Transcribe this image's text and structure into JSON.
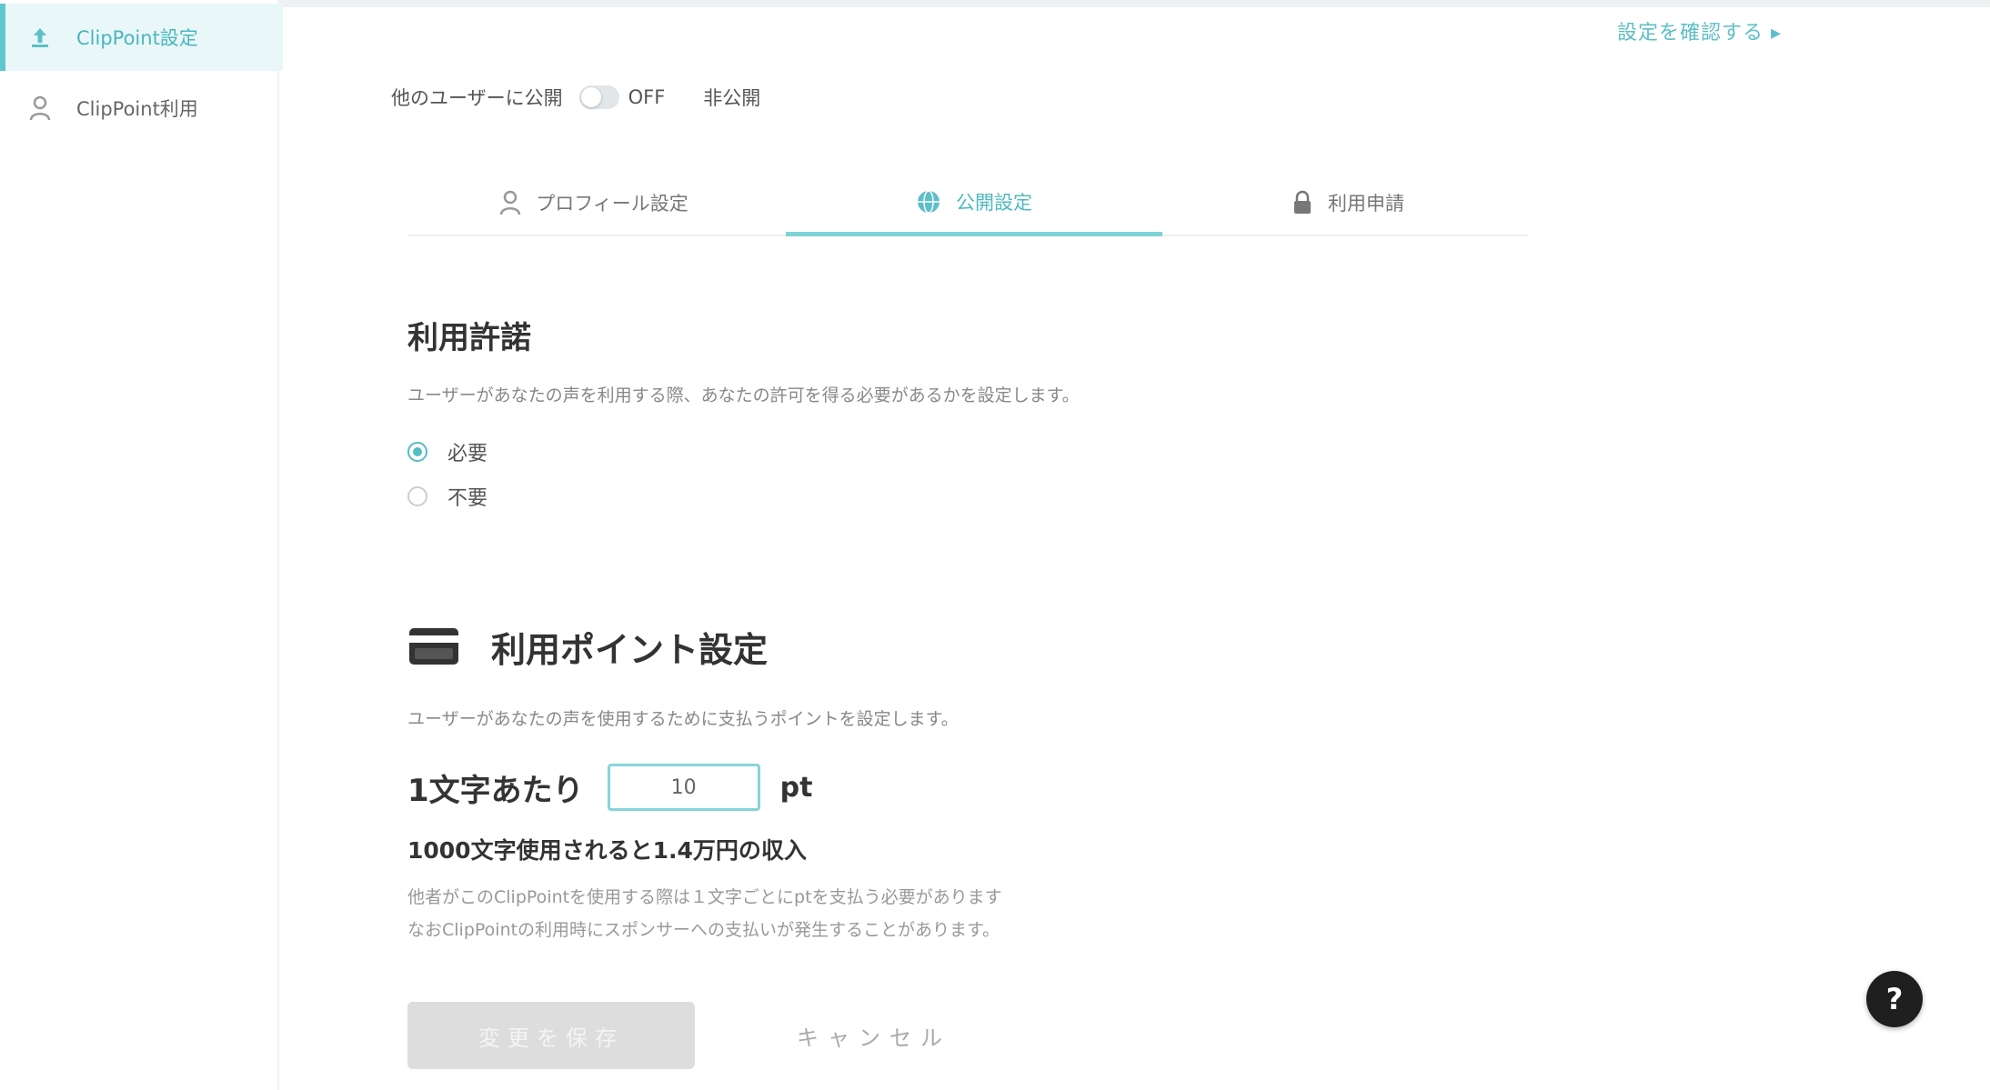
{
  "sidebar": {
    "items": [
      {
        "label": "ClipPoint設定",
        "icon": "upload-icon",
        "active": true
      },
      {
        "label": "ClipPoint利用",
        "icon": "user-icon",
        "active": false
      }
    ]
  },
  "header": {
    "top_link": "設定を確認する ▸"
  },
  "publish": {
    "label": "他のユーザーに公開",
    "toggle_state": "OFF",
    "status": "非公開"
  },
  "tabs": [
    {
      "label": "プロフィール設定",
      "icon": "user-icon",
      "active": false
    },
    {
      "label": "公開設定",
      "icon": "globe-icon",
      "active": true
    },
    {
      "label": "利用申請",
      "icon": "lock-icon",
      "active": false
    }
  ],
  "usage": {
    "title": "利用許諾",
    "desc": "ユーザーがあなたの声を利用する際、あなたの許可を得る必要があるかを設定します。",
    "options": [
      {
        "label": "必要",
        "selected": true
      },
      {
        "label": "不要",
        "selected": false
      }
    ]
  },
  "points": {
    "title": "利用ポイント設定",
    "desc": "ユーザーがあなたの声を使用するために支払うポイントを設定します。",
    "per_char_label": "1文字あたり",
    "value": "10",
    "unit": "pt",
    "earn": "1000文字使用されると1.4万円の収入",
    "note1": "他者がこのClipPointを使用する際は１文字ごとにptを支払う必要があります",
    "note2": "なおClipPointの利用時にスポンサーへの支払いが発生することがあります。"
  },
  "buttons": {
    "save": "変更を保存",
    "cancel": "キャンセル",
    "help": "?"
  },
  "colors": {
    "accent": "#5dbfc7",
    "active_bg": "#e9f7f8"
  }
}
